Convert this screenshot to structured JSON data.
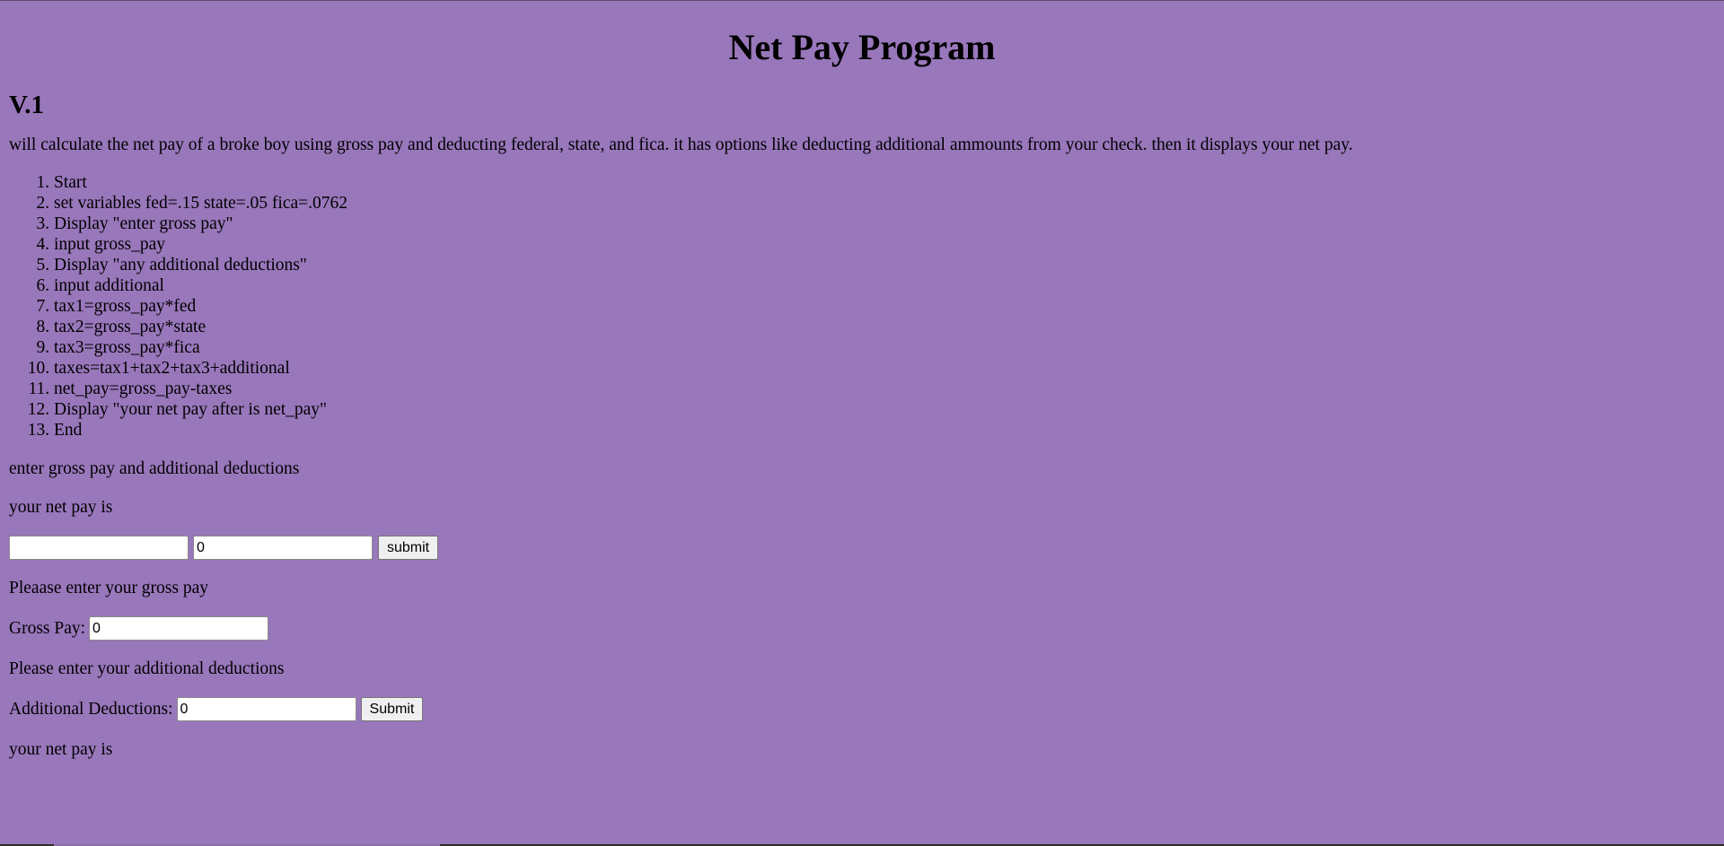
{
  "header": {
    "title": "Net Pay Program",
    "version": "V.1"
  },
  "description": "will calculate the net pay of a broke boy using gross pay and deducting federal, state, and fica. it has options like deducting additional ammounts from your check. then it displays your net pay.",
  "steps": [
    "Start",
    "set variables fed=.15 state=.05 fica=.0762",
    "Display \"enter gross pay\"",
    "input gross_pay",
    "Display \"any additional deductions\"",
    "input additional",
    "tax1=gross_pay*fed",
    "tax2=gross_pay*state",
    "tax3=gross_pay*fica",
    "taxes=tax1+tax2+tax3+additional",
    "net_pay=gross_pay-taxes",
    "Display \"your net pay after is net_pay\"",
    "End"
  ],
  "form1": {
    "prompt": "enter gross pay and additional deductions",
    "result_label": "your net pay is",
    "gross_value": "",
    "additional_value": "0",
    "submit_label": "submit"
  },
  "form2": {
    "gross_prompt": "Pleaase enter your gross pay",
    "gross_label": "Gross Pay:",
    "gross_value": "0",
    "additional_prompt": "Please enter your additional deductions",
    "additional_label": "Additional Deductions:",
    "additional_value": "0",
    "submit_label": "Submit",
    "result_label": "your net pay is"
  },
  "colors": {
    "background": "#9977bb"
  }
}
